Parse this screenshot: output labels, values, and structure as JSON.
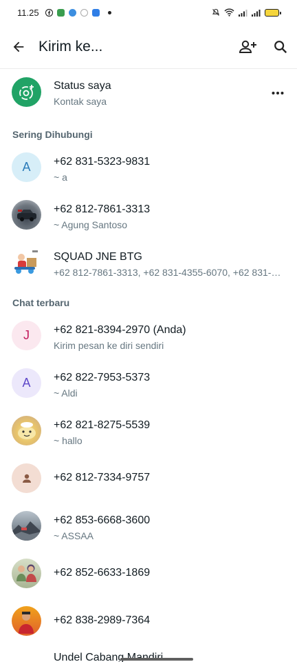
{
  "statusbar": {
    "time": "11.25"
  },
  "appbar": {
    "title": "Kirim ke..."
  },
  "my_status": {
    "title": "Status saya",
    "subtitle": "Kontak saya"
  },
  "sections": {
    "frequent": "Sering Dihubungi",
    "recent": "Chat terbaru"
  },
  "frequent": [
    {
      "initial": "A",
      "name": "+62 831-5323-9831",
      "sub": "~ a"
    },
    {
      "initial": "",
      "name": "+62 812-7861-3313",
      "sub": "~ Agung Santoso"
    },
    {
      "initial": "",
      "name": "SQUAD JNE BTG",
      "sub": "+62 812-7861-3313, +62 831-4355-6070, +62 831-6…"
    }
  ],
  "recent": [
    {
      "initial": "J",
      "name": "+62 821-8394-2970 (Anda)",
      "sub": "Kirim pesan ke diri sendiri"
    },
    {
      "initial": "A",
      "name": "+62 822-7953-5373",
      "sub": "~ Aldi"
    },
    {
      "initial": "",
      "name": "+62 821-8275-5539",
      "sub": "~ hallo"
    },
    {
      "initial": "",
      "name": "+62 812-7334-9757",
      "sub": ""
    },
    {
      "initial": "",
      "name": "+62 853-6668-3600",
      "sub": "~ ASSAA"
    },
    {
      "initial": "",
      "name": "+62 852-6633-1869",
      "sub": ""
    },
    {
      "initial": "",
      "name": "+62 838-2989-7364",
      "sub": ""
    }
  ],
  "partial_row": {
    "name": "Undel Cabang Mandiri"
  },
  "colors": {
    "accent": "#21a366",
    "status_ring": "#25d366",
    "avatar_a_bg": "#d7eef8",
    "avatar_a_fg": "#2b7bb9",
    "avatar_j_bg": "#fbe8ef",
    "avatar_j_fg": "#c2185b",
    "avatar_a2_bg": "#ece8fb",
    "avatar_a2_fg": "#5e48c8",
    "default_avatar_bg": "#f3ddd3",
    "default_avatar_fg": "#8a5a44"
  }
}
